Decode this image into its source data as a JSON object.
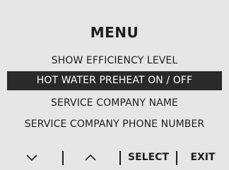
{
  "menu": {
    "title": "MENU",
    "items": [
      {
        "label": "SHOW EFFICIENCY LEVEL",
        "selected": false
      },
      {
        "label": "HOT WATER PREHEAT ON / OFF",
        "selected": true
      },
      {
        "label": "SERVICE COMPANY NAME",
        "selected": false
      },
      {
        "label": "SERVICE COMPANY PHONE NUMBER",
        "selected": false
      }
    ]
  },
  "softkeys": {
    "down_icon": "chevron-down-icon",
    "up_icon": "chevron-up-icon",
    "select_label": "SELECT",
    "exit_label": "EXIT"
  },
  "colors": {
    "background": "#e6e6e6",
    "highlight": "#2a2a2a",
    "text": "#1e1e1e"
  }
}
